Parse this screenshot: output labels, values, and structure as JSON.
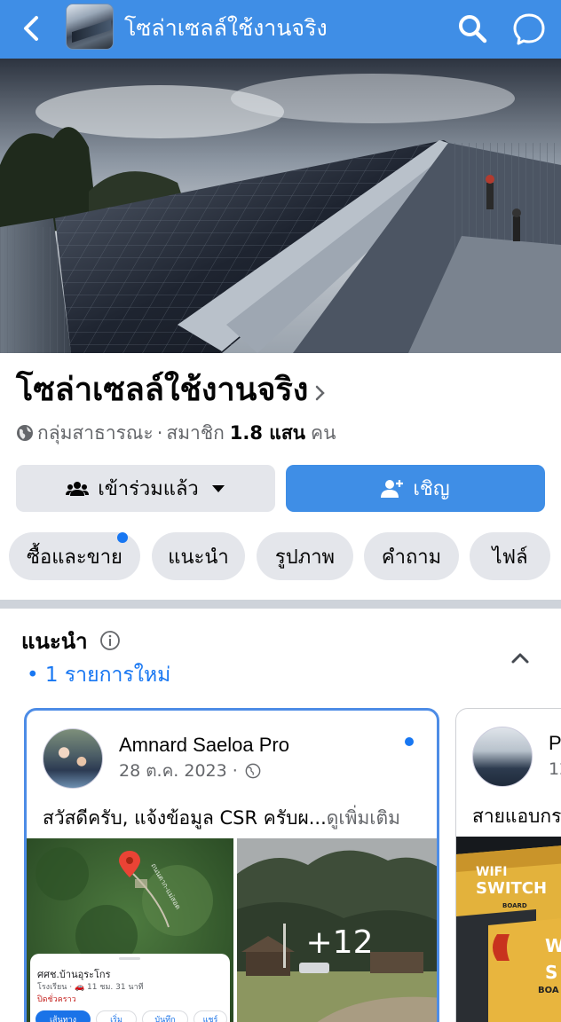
{
  "topbar": {
    "title": "โซล่าเซลล์ใช้งานจริง",
    "icons": [
      "back-arrow-icon",
      "search-icon",
      "messenger-icon"
    ]
  },
  "group": {
    "name": "โซล่าเซลล์ใช้งานจริง",
    "privacy": "กลุ่มสาธารณะ",
    "separator": "·",
    "members_label": "สมาชิก",
    "members_count": "1.8 แสน",
    "members_unit": "คน"
  },
  "actions": {
    "joined_label": "เข้าร่วมแล้ว",
    "invite_label": "เชิญ"
  },
  "tabs": [
    {
      "label": "ซื้อและขาย",
      "has_badge": true
    },
    {
      "label": "แนะนำ",
      "has_badge": false
    },
    {
      "label": "รูปภาพ",
      "has_badge": false
    },
    {
      "label": "คำถาม",
      "has_badge": false
    },
    {
      "label": "ไฟล์",
      "has_badge": false
    }
  ],
  "featured": {
    "title": "แนะนำ",
    "new_items": "• 1 รายการใหม่",
    "cards": [
      {
        "author": "Amnard Saeloa Pro",
        "date": "28 ต.ค. 2023 ·",
        "text": "สวัสดีครับ, แจ้งข้อมูล CSR ครับผ...",
        "see_more": "ดูเพิ่มเติม",
        "more_photos": "+12",
        "map_place": "ศศช.บ้านอุระโกร",
        "map_info": "โรงเรียน · 🚗 11 ชม. 31 นาที",
        "map_status": "ปิดชั่วคราว",
        "map_buttons": [
          "เส้นทาง",
          "เริ่ม",
          "บันทึก",
          "แชร์"
        ],
        "map_road": "ถนนตาก-แม่สอด"
      },
      {
        "author": "P",
        "date": "12",
        "text": "สายแอบกร",
        "box_text_1": "WIFI",
        "box_text_2": "SWITCH",
        "box_text_3": "BOARD",
        "box_text_4": "W",
        "box_text_5": "S",
        "box_text_6": "BOA"
      }
    ]
  },
  "colors": {
    "brand_blue": "#3f8ee6",
    "link_blue": "#1877f2",
    "chip_gray": "#e4e6eb",
    "muted_text": "#65676b"
  }
}
